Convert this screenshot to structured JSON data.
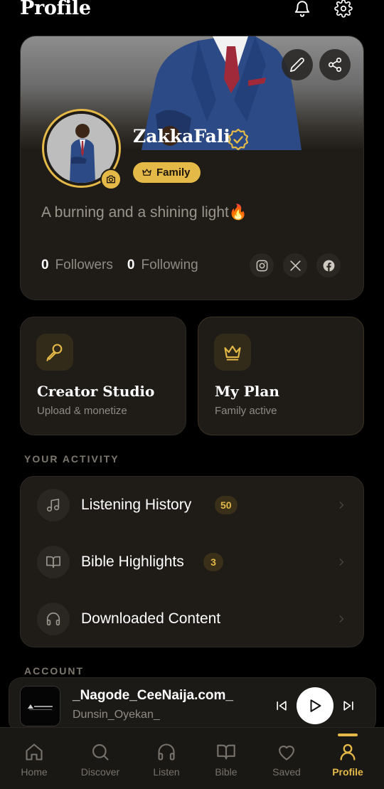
{
  "header": {
    "title": "Profile"
  },
  "profile": {
    "username": "ZakkaFali",
    "plan_badge": "Family",
    "bio": "A burning and a shining light🔥",
    "followers_count": "0",
    "followers_label": "Followers",
    "following_count": "0",
    "following_label": "Following"
  },
  "tiles": {
    "creator_title": "Creator Studio",
    "creator_sub": "Upload & monetize",
    "plan_title": "My Plan",
    "plan_sub": "Family active"
  },
  "sections": {
    "activity": "YOUR ACTIVITY",
    "account": "ACCOUNT"
  },
  "activity": [
    {
      "label": "Listening History",
      "count": "50"
    },
    {
      "label": "Bible Highlights",
      "count": "3"
    },
    {
      "label": "Downloaded Content",
      "count": ""
    }
  ],
  "player": {
    "title": "_Nagode_CeeNaija.com_",
    "artist": "Dunsin_Oyekan_"
  },
  "tabs": [
    {
      "label": "Home",
      "icon": "home-icon"
    },
    {
      "label": "Discover",
      "icon": "search-icon"
    },
    {
      "label": "Listen",
      "icon": "headphones-icon"
    },
    {
      "label": "Bible",
      "icon": "book-icon"
    },
    {
      "label": "Saved",
      "icon": "heart-icon"
    },
    {
      "label": "Profile",
      "icon": "user-icon"
    }
  ],
  "colors": {
    "accent": "#e5b948",
    "background": "#000000",
    "card": "#1f1c18"
  }
}
